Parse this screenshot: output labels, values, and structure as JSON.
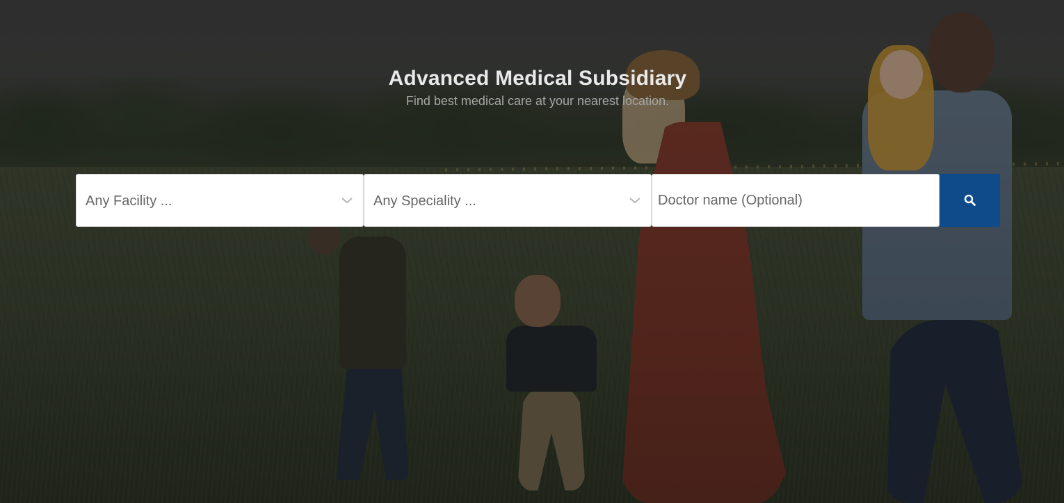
{
  "hero": {
    "title": "Advanced Medical Subsidiary",
    "subtitle": "Find best medical care at your nearest location."
  },
  "search": {
    "facility": {
      "selected": "Any Facility ..."
    },
    "speciality": {
      "selected": "Any Speciality ..."
    },
    "doctor": {
      "placeholder": "Doctor name (Optional)",
      "value": ""
    },
    "button_icon": "search-icon"
  },
  "colors": {
    "button": "#0f4a8a",
    "title": "#e9e9e9",
    "subtitle": "#a7a7a7"
  }
}
